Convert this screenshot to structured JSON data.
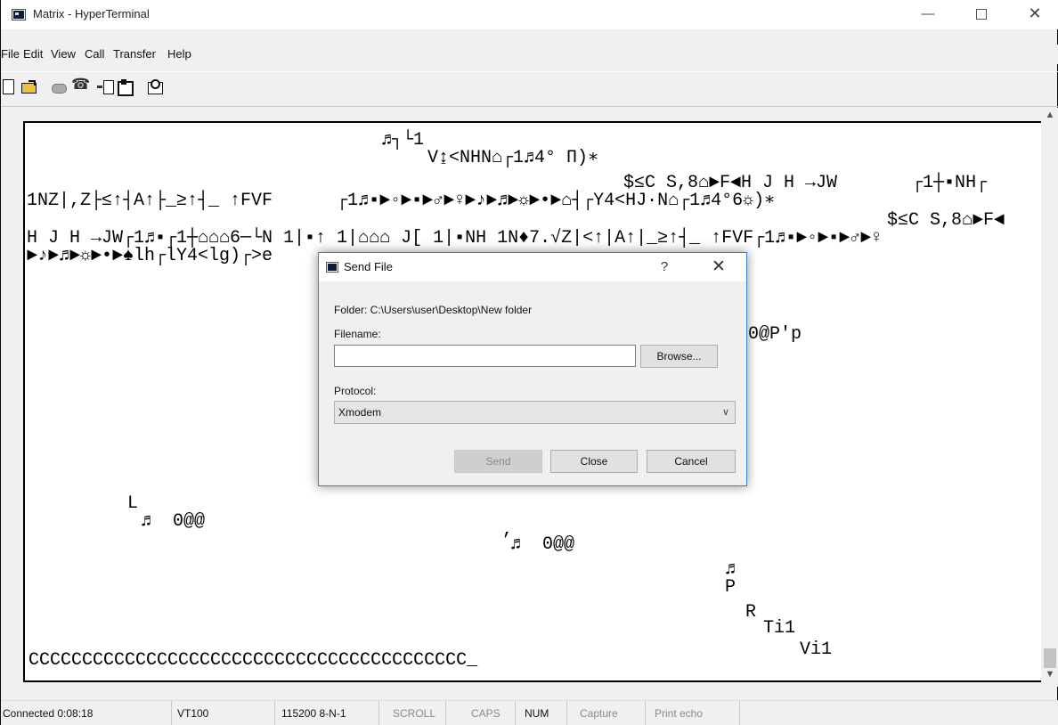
{
  "window": {
    "title": "Matrix - HyperTerminal",
    "minimize_glyph": "—",
    "close_glyph": "✕"
  },
  "menu": {
    "file": "File",
    "edit": "Edit",
    "view": "View",
    "call": "Call",
    "transfer": "Transfer",
    "help": "Help"
  },
  "toolbar": {
    "icons": [
      "new-icon",
      "open-icon",
      "connect-icon",
      "disconnect-icon",
      "send-icon",
      "receive-icon",
      "properties-icon"
    ]
  },
  "terminal": {
    "lines": [
      "♬┐└1",
      "V↨<NHN⌂┌1♬4° Π)∗",
      "$≤C S,8⌂►F◄H J H →JW       ┌1┼▪NH┌",
      "1NZ|,Z├≤↑┤A↑├_≥↑┤_ ↑FVF      ┌1♬▪►◦►▪►♂►♀►♪►♬►☼►•►⌂┤┌Y4<HJ·N⌂┌1♬4°6☼)∗",
      "$≤C S,8⌂►F◄",
      "H J H →JW┌1♬▪┌1┼⌂⌂⌂6─└N 1|▪↑ 1|⌂⌂⌂ J[ 1|▪NH 1N♦7.√Z|<↑|A↑|_≥↑┤_ ↑FVF┌1♬▪►◦►▪►♂►♀",
      "►♪►♬►☼►•►♠lh┌lY4<lg)┌>e",
      "0@P'p",
      "L",
      "♬  0@@",
      ",",
      "♬  0@@",
      "♬",
      "P",
      "R",
      "Ti1",
      "Vi1",
      "CCCCCCCCCCCCCCCCCCCCCCCCCCCCCCCCCCCCCCCCC_"
    ]
  },
  "statusbar": {
    "connected": "Connected 0:08:18",
    "emulation": "VT100",
    "port_settings": "115200 8-N-1",
    "scroll": "SCROLL",
    "caps": "CAPS",
    "num": "NUM",
    "capture": "Capture",
    "print_echo": "Print echo"
  },
  "dialog": {
    "title": "Send File",
    "help_glyph": "?",
    "close_glyph": "✕",
    "folder_label": "Folder: C:\\Users\\user\\Desktop\\New folder",
    "filename_label": "Filename:",
    "filename_value": "",
    "browse_label": "Browse...",
    "protocol_label": "Protocol:",
    "protocol_value": "Xmodem",
    "send_label": "Send",
    "close_label": "Close",
    "cancel_label": "Cancel"
  }
}
